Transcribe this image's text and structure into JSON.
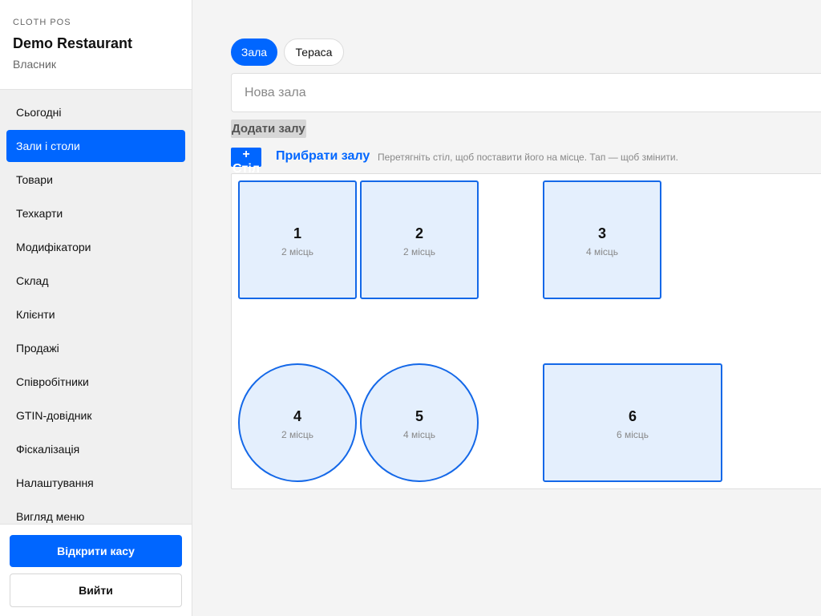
{
  "brand": {
    "app": "CLOTH POS",
    "name": "Demo Restaurant",
    "role": "Власник"
  },
  "nav": {
    "items": [
      {
        "label": "Сьогодні",
        "active": false
      },
      {
        "label": "Зали і столи",
        "active": true
      },
      {
        "label": "Товари",
        "active": false
      },
      {
        "label": "Техкарти",
        "active": false
      },
      {
        "label": "Модифікатори",
        "active": false
      },
      {
        "label": "Склад",
        "active": false
      },
      {
        "label": "Клієнти",
        "active": false
      },
      {
        "label": "Продажі",
        "active": false
      },
      {
        "label": "Співробітники",
        "active": false
      },
      {
        "label": "GTIN-довідник",
        "active": false
      },
      {
        "label": "Фіскалізація",
        "active": false
      },
      {
        "label": "Налаштування",
        "active": false
      },
      {
        "label": "Вигляд меню",
        "active": false
      }
    ]
  },
  "footer": {
    "open_register": "Відкрити касу",
    "logout": "Вийти"
  },
  "halls": {
    "tabs": [
      {
        "label": "Зала",
        "active": true
      },
      {
        "label": "Тераса",
        "active": false
      }
    ],
    "new_hall_placeholder": "Нова зала",
    "add_hall_label": "Додати залу"
  },
  "toolbar": {
    "add_table": "+ Стіл",
    "remove_hall": "Прибрати залу",
    "hint": "Перетягніть стіл, щоб поставити його на місце. Тап — щоб змінити."
  },
  "tables": [
    {
      "number": "1",
      "seats": "2 місць",
      "shape": "square"
    },
    {
      "number": "2",
      "seats": "2 місць",
      "shape": "square"
    },
    {
      "number": "3",
      "seats": "4 місць",
      "shape": "square"
    },
    {
      "number": "4",
      "seats": "2 місць",
      "shape": "round"
    },
    {
      "number": "5",
      "seats": "4 місць",
      "shape": "round"
    },
    {
      "number": "6",
      "seats": "6 місць",
      "shape": "rect"
    }
  ],
  "colors": {
    "accent": "#0066ff",
    "table_fill": "#e4effd",
    "table_border": "#1468e8"
  }
}
